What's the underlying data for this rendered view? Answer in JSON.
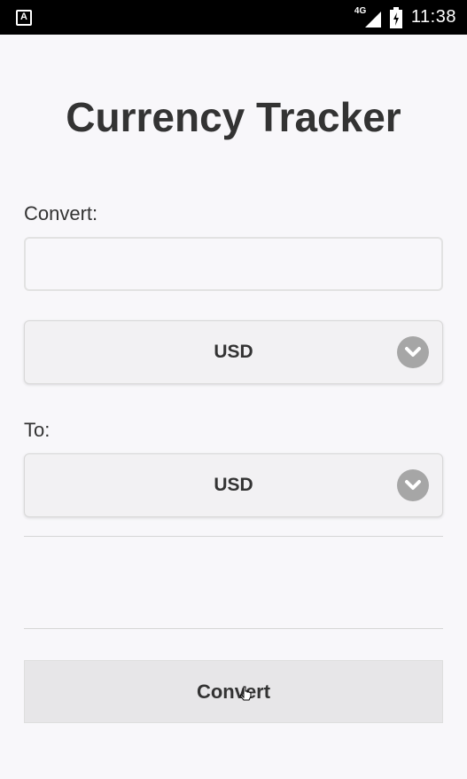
{
  "status_bar": {
    "notification_icon_letter": "A",
    "network_type": "4G",
    "time": "11:38",
    "icons": [
      "notification-icon",
      "signal-icon",
      "battery-icon"
    ]
  },
  "app": {
    "title": "Currency Tracker"
  },
  "form": {
    "convert_label": "Convert:",
    "amount_value": "",
    "amount_placeholder": "",
    "from_currency": "USD",
    "to_label": "To:",
    "to_currency": "USD",
    "result_text": "",
    "convert_button_label": "Convert"
  },
  "colors": {
    "background": "#f8f7fa",
    "status_bar": "#000000",
    "text": "#333333",
    "chevron_circle": "#a6a6a6",
    "button_background": "#e7e6e8"
  }
}
